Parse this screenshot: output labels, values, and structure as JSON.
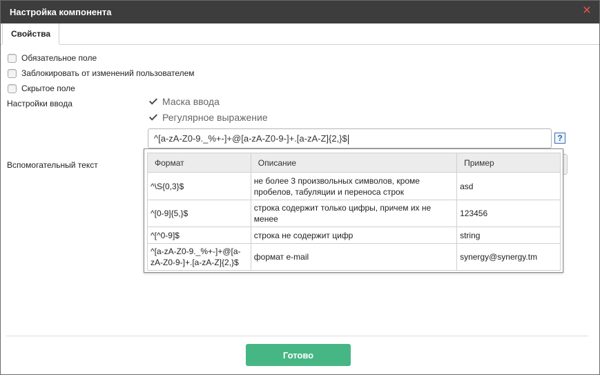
{
  "window": {
    "title": "Настройка компонента",
    "close_icon": "close-icon",
    "close_color": "#e2524f"
  },
  "tabs": [
    {
      "label": "Свойства",
      "active": true
    }
  ],
  "checkboxes": [
    {
      "label": "Обязательное поле",
      "checked": false
    },
    {
      "label": "Заблокировать от изменений пользователем",
      "checked": false
    },
    {
      "label": "Скрытое поле",
      "checked": false
    }
  ],
  "input_settings": {
    "label": "Настройки ввода",
    "options": [
      {
        "label": "Маска ввода",
        "checked": true
      },
      {
        "label": "Регулярное выражение",
        "checked": true
      }
    ],
    "regex_value": "^[a-zA-Z0-9._%+-]+@[a-zA-Z0-9-]+.[a-zA-Z]{2,}$",
    "help_label": "?"
  },
  "helper_text": {
    "label": "Вспомогательный текст"
  },
  "format_table": {
    "headers": [
      "Формат",
      "Описание",
      "Пример"
    ],
    "rows": [
      {
        "format": "^\\S{0,3}$",
        "description": "не более 3 произвольных символов, кроме пробелов, табуляции и переноса строк",
        "example": "asd"
      },
      {
        "format": "^[0-9]{5,}$",
        "description": "строка содержит только цифры, причем их не менее",
        "example": "123456"
      },
      {
        "format": "^[^0-9]$",
        "description": "строка не содержит цифр",
        "example": "string"
      },
      {
        "format": "^[a-zA-Z0-9._%+-]+@[a-zA-Z0-9-]+.[a-zA-Z]{2,}$",
        "description": "формат e-mail",
        "example": "synergy@synergy.tm"
      }
    ]
  },
  "footer": {
    "done_label": "Готово",
    "done_color": "#46b685"
  }
}
